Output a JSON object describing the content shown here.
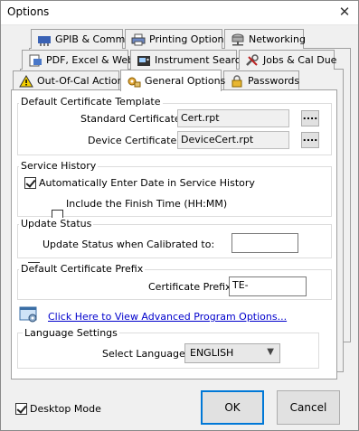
{
  "window": {
    "title": "Options"
  },
  "tabs": {
    "row1": [
      {
        "label": "GPIB & Comms",
        "icon": "network-card-icon"
      },
      {
        "label": "Printing Options",
        "icon": "printer-icon"
      },
      {
        "label": "Networking",
        "icon": "network-drive-icon"
      }
    ],
    "row2": [
      {
        "label": "PDF, Excel & Web",
        "icon": "document-export-icon"
      },
      {
        "label": "Instrument Search",
        "icon": "instrument-icon"
      },
      {
        "label": "Jobs & Cal Due",
        "icon": "tools-icon"
      }
    ],
    "row3": [
      {
        "label": "Out-Of-Cal Action",
        "icon": "warning-icon"
      },
      {
        "label": "General Options",
        "icon": "settings-icon",
        "active": true
      },
      {
        "label": "Passwords",
        "icon": "lock-icon"
      }
    ]
  },
  "certificate_template": {
    "group_label": "Default Certificate Template",
    "standard_label": "Standard Certificate:",
    "standard_value": "Cert.rpt",
    "device_label": "Device Certificate:",
    "device_value": "DeviceCert.rpt",
    "browse_label": "...."
  },
  "service_history": {
    "group_label": "Service History",
    "auto_date_label": "Automatically Enter Date in Service History",
    "auto_date_checked": true,
    "finish_time_label": "Include the Finish Time (HH:MM)",
    "finish_time_checked": false
  },
  "update_status": {
    "group_label": "Update Status",
    "checkbox_label": "Update Status when Calibrated to:",
    "checked": true,
    "value": ""
  },
  "certificate_prefix": {
    "group_label": "Default Certificate Prefix",
    "label": "Certificate Prefix:",
    "value": "TE-"
  },
  "advanced": {
    "link_label": "Click Here to View Advanced Program Options..."
  },
  "language": {
    "group_label": "Language Settings",
    "label": "Select Language:",
    "value": "ENGLISH"
  },
  "footer": {
    "desktop_mode_label": "Desktop Mode",
    "desktop_mode_checked": true,
    "ok_label": "OK",
    "cancel_label": "Cancel"
  },
  "colors": {
    "link": "#0000cc",
    "default_button_border": "#0078d7",
    "window_bg": "#f0f0f0"
  }
}
